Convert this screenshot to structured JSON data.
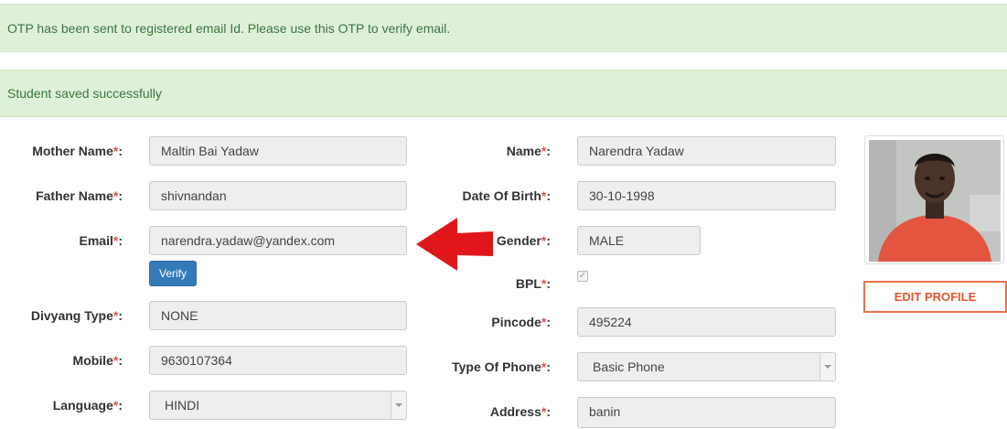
{
  "alerts": {
    "otp": "OTP has been sent to registered email Id. Please use this OTP to verify email.",
    "saved": "Student saved successfully"
  },
  "left_form": {
    "mother_name": {
      "label": "Mother Name",
      "value": "Maltin Bai Yadaw"
    },
    "father_name": {
      "label": "Father Name",
      "value": "shivnandan"
    },
    "email": {
      "label": "Email",
      "value": "narendra.yadaw@yandex.com"
    },
    "verify_button": "Verify",
    "divyang_type": {
      "label": "Divyang Type",
      "value": "NONE"
    },
    "mobile": {
      "label": "Mobile",
      "value": "9630107364"
    },
    "language": {
      "label": "Language",
      "value": "HINDI"
    }
  },
  "right_form": {
    "name": {
      "label": "Name",
      "value": "Narendra Yadaw"
    },
    "dob": {
      "label": "Date Of Birth",
      "value": "30-10-1998"
    },
    "gender": {
      "label": "Gender",
      "value": "MALE"
    },
    "bpl": {
      "label": "BPL",
      "checked": true
    },
    "pincode": {
      "label": "Pincode",
      "value": "495224"
    },
    "phone_type": {
      "label": "Type Of Phone",
      "value": "Basic Phone"
    },
    "address": {
      "label": "Address",
      "value": "banin"
    }
  },
  "profile": {
    "edit_button": "EDIT PROFILE"
  },
  "common": {
    "required_marker": "*",
    "colon": ":"
  },
  "colors": {
    "alert_bg": "#dff0d8",
    "alert_text": "#3c763d",
    "required": "#d9534f",
    "primary": "#337ab7",
    "edit_border": "#e8734f",
    "arrow": "#e0161b"
  }
}
